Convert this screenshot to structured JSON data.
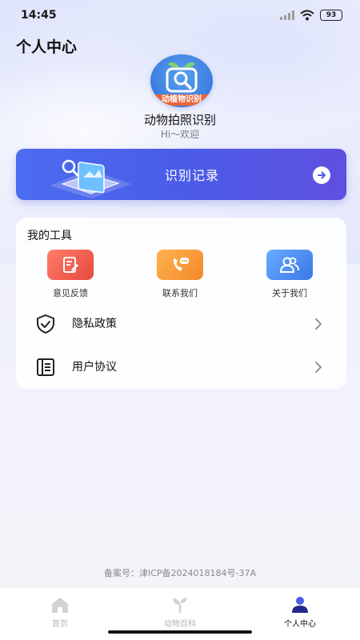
{
  "status_bar": {
    "time": "14:45",
    "battery": "93"
  },
  "header": {
    "title": "个人中心"
  },
  "profile": {
    "logo_banner": "动植物识别",
    "app_name": "动物拍照识别",
    "greeting": "Hi～欢迎"
  },
  "record_banner": {
    "label": "识别记录"
  },
  "tools": {
    "title": "我的工具",
    "items": [
      {
        "label": "意见反馈",
        "icon": "feedback-icon",
        "color": "#ee5a4e"
      },
      {
        "label": "联系我们",
        "icon": "phone-chat-icon",
        "color": "#f39a3d"
      },
      {
        "label": "关于我们",
        "icon": "users-icon",
        "color": "#4a8ef0"
      }
    ],
    "menu": [
      {
        "label": "隐私政策",
        "icon": "shield-check-icon"
      },
      {
        "label": "用户协议",
        "icon": "document-icon"
      }
    ]
  },
  "footer": {
    "icp": "备案号：津ICP备2024018184号-37A"
  },
  "tab_bar": {
    "tabs": [
      {
        "label": "首页",
        "icon": "home-icon",
        "active": false
      },
      {
        "label": "动物百科",
        "icon": "sprout-icon",
        "active": false
      },
      {
        "label": "个人中心",
        "icon": "person-icon",
        "active": true
      }
    ]
  },
  "colors": {
    "accent": "#4c5ce8",
    "active_tab": "#111111",
    "inactive_tab": "#b5b5b5"
  }
}
